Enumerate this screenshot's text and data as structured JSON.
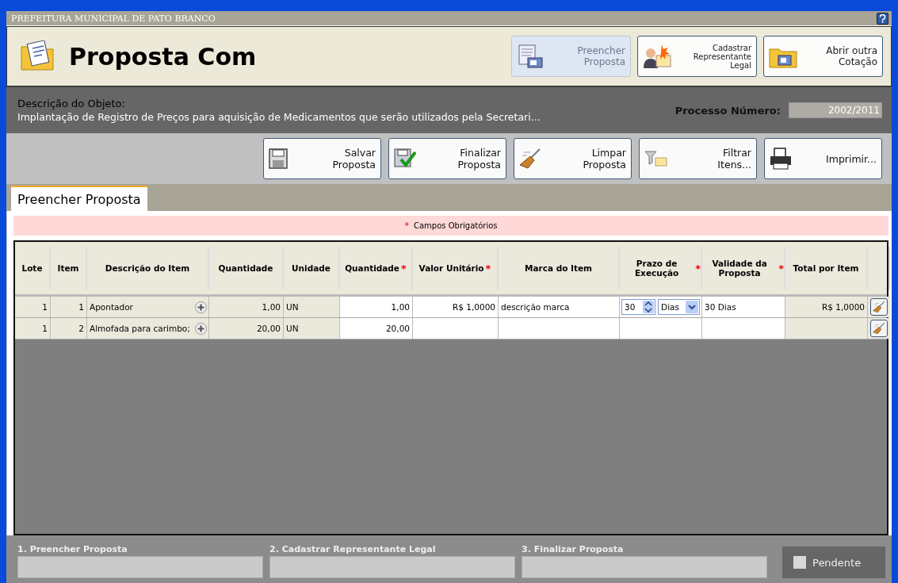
{
  "app_bar": {
    "title": "PREFEITURA MUNICIPAL DE PATO BRANCO"
  },
  "header": {
    "title": "Proposta Com",
    "buttons": [
      {
        "label": "Preencher Proposta",
        "selected": true
      },
      {
        "label": "Cadastrar Representante Legal",
        "selected": false
      },
      {
        "label": "Abrir outra Cotação",
        "selected": false
      }
    ]
  },
  "object": {
    "label": "Descrição do Objeto:",
    "description": "Implantação de Registro de Preços para aquisição de Medicamentos que serão utilizados pela Secretari...",
    "process_label": "Processo Número:",
    "process_value": "2002/2011"
  },
  "toolbar": [
    {
      "label": "Salvar Proposta"
    },
    {
      "label": "Finalizar Proposta"
    },
    {
      "label": "Limpar Proposta"
    },
    {
      "label": "Filtrar Itens..."
    },
    {
      "label": "Imprimir..."
    }
  ],
  "tabs": [
    {
      "label": "Preencher Proposta",
      "selected": true
    }
  ],
  "notice": {
    "mark": "*",
    "text": "Campos Obrigatórios"
  },
  "table": {
    "columns": [
      {
        "label": "Lote",
        "required": false
      },
      {
        "label": "Item",
        "required": false
      },
      {
        "label": "Descrição do Item",
        "required": false
      },
      {
        "label": "Quantidade",
        "required": false
      },
      {
        "label": "Unidade",
        "required": false
      },
      {
        "label": "Quantidade",
        "required": true
      },
      {
        "label": "Valor Unitário",
        "required": true
      },
      {
        "label": "Marca do Item",
        "required": false
      },
      {
        "label": "Prazo de Execução",
        "required": true
      },
      {
        "label": "Validade da Proposta",
        "required": true
      },
      {
        "label": "Total por Item",
        "required": false
      }
    ],
    "rows": [
      {
        "lote": "1",
        "item": "1",
        "descricao": "Apontador",
        "quantidade": "1,00",
        "unidade": "UN",
        "quantidade_proposta": "1,00",
        "valor_unitario": "R$ 1,0000",
        "marca": "descrição marca",
        "prazo": {
          "value": "30",
          "unit": "Dias"
        },
        "validade": "30 Dias",
        "total": "R$ 1,0000"
      },
      {
        "lote": "1",
        "item": "2",
        "descricao": "Almofada para carimbo;",
        "quantidade": "20,00",
        "unidade": "UN",
        "quantidade_proposta": "20,00"
      }
    ]
  },
  "steps": [
    {
      "label": "1. Preencher Proposta"
    },
    {
      "label": "2. Cadastrar Representante Legal"
    },
    {
      "label": "3. Finalizar Proposta"
    }
  ],
  "legend": [
    {
      "label": "Pendente",
      "color": "#d8d8d8"
    }
  ]
}
